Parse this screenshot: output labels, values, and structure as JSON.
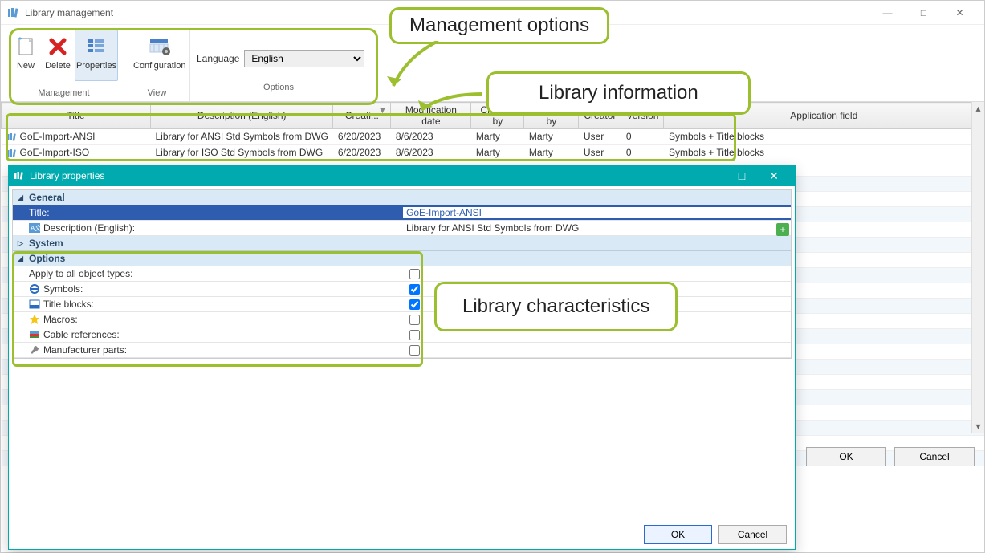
{
  "window": {
    "title": "Library management",
    "min": "—",
    "max": "□",
    "close": "✕"
  },
  "ribbon": {
    "management": {
      "group_label": "Management",
      "new": "New",
      "delete": "Delete",
      "properties": "Properties"
    },
    "view": {
      "group_label": "View",
      "configuration": "Configuration"
    },
    "options": {
      "group_label": "Options",
      "language_label": "Language",
      "language_value": "English"
    }
  },
  "annotations": {
    "mgmt_options": "Management options",
    "lib_info": "Library information",
    "lib_char": "Library characteristics"
  },
  "table": {
    "headers": {
      "title": "Title",
      "description": "Description (English)",
      "creation": "Creati...",
      "modification": "Modification date",
      "created_by": "Created by",
      "modified_by": "Modified by",
      "creator": "Creator",
      "version": "Version",
      "application_field": "Application field"
    },
    "rows": [
      {
        "title": "GoE-Import-ANSI",
        "description": "Library for ANSI Std Symbols from DWG",
        "creation": "6/20/2023",
        "modification": "8/6/2023",
        "created_by": "Marty",
        "modified_by": "Marty",
        "creator": "User",
        "version": "0",
        "application_field": "Symbols + Title blocks"
      },
      {
        "title": "GoE-Import-ISO",
        "description": "Library for ISO Std Symbols from DWG",
        "creation": "6/20/2023",
        "modification": "8/6/2023",
        "created_by": "Marty",
        "modified_by": "Marty",
        "creator": "User",
        "version": "0",
        "application_field": "Symbols + Title blocks"
      }
    ]
  },
  "main_footer": {
    "ok": "OK",
    "cancel": "Cancel"
  },
  "props": {
    "title": "Library properties",
    "sections": {
      "general": "General",
      "system": "System",
      "options": "Options"
    },
    "general": {
      "title_label": "Title:",
      "title_value": "GoE-Import-ANSI",
      "desc_label": "Description (English):",
      "desc_value": "Library for ANSI Std Symbols from DWG"
    },
    "options": {
      "apply_all": "Apply to all object types:",
      "symbols": "Symbols:",
      "title_blocks": "Title blocks:",
      "macros": "Macros:",
      "cable_refs": "Cable references:",
      "manuf_parts": "Manufacturer parts:"
    },
    "footer": {
      "ok": "OK",
      "cancel": "Cancel"
    }
  }
}
